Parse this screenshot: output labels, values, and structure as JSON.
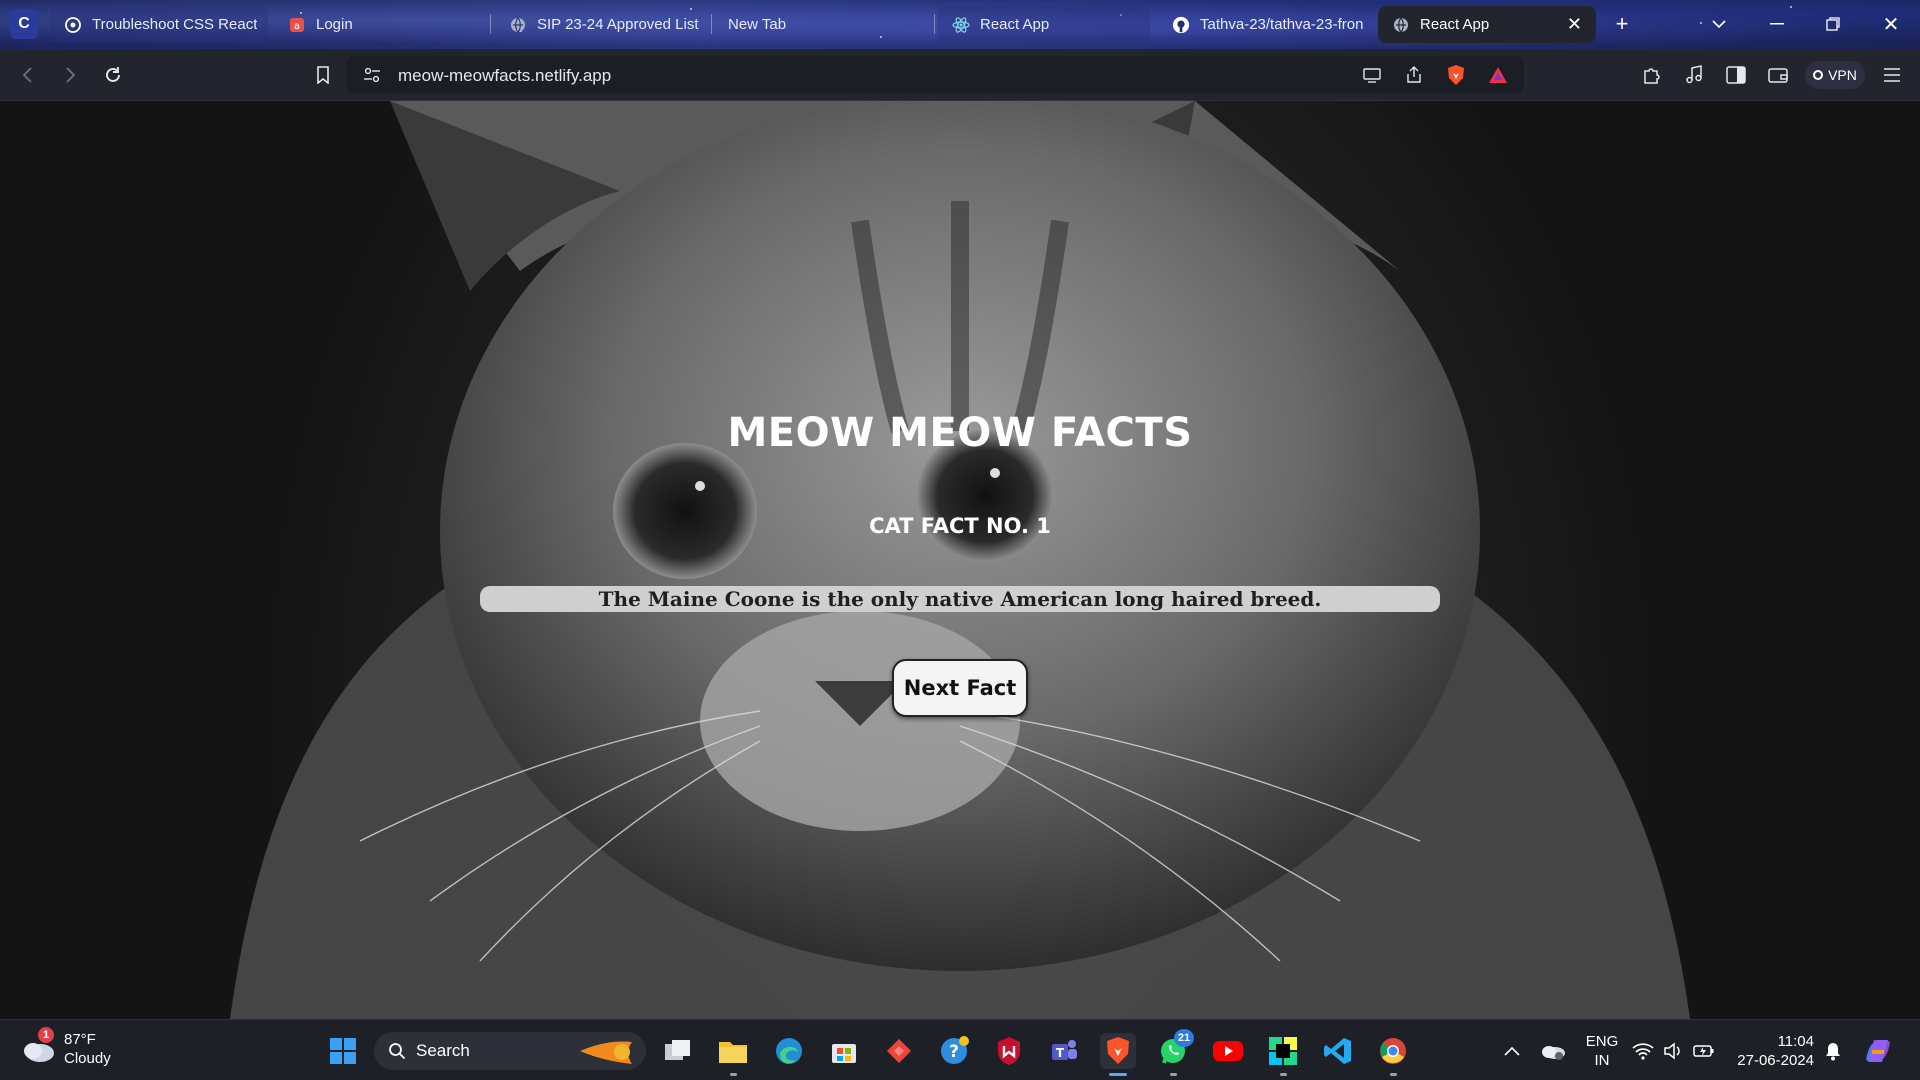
{
  "browser": {
    "tabs": [
      {
        "title": "Troubleshoot CSS React",
        "favicon": "openai-icon"
      },
      {
        "title": "Login",
        "favicon": "app-icon"
      },
      {
        "title": "SIP 23-24 Approved List",
        "favicon": "globe-icon"
      },
      {
        "title": "New Tab",
        "favicon": ""
      },
      {
        "title": "React App",
        "favicon": "react-icon"
      },
      {
        "title": "Tathva-23/tathva-23-fron",
        "favicon": "github-icon"
      },
      {
        "title": "React App",
        "favicon": "globe-icon",
        "active": true
      }
    ],
    "address": "meow-meowfacts.netlify.app",
    "vpn_label": "VPN"
  },
  "page": {
    "title": "MEOW MEOW FACTS",
    "fact_number_label": "CAT FACT NO. 1",
    "fact_text": "The Maine Coone is the only native American long haired breed.",
    "next_button": "Next Fact"
  },
  "taskbar": {
    "weather": {
      "temp": "87°F",
      "condition": "Cloudy",
      "alert_count": "1"
    },
    "search_label": "Search",
    "whatsapp_badge": "21",
    "lang_line1": "ENG",
    "lang_line2": "IN",
    "time": "11:04",
    "date": "27-06-2024"
  },
  "colors": {
    "tab_strip": "#232c6e",
    "toolbar": "#23252e",
    "taskbar": "#1e2027",
    "fact_box": "#cfcfcf",
    "accent": "#5aa8ff"
  }
}
